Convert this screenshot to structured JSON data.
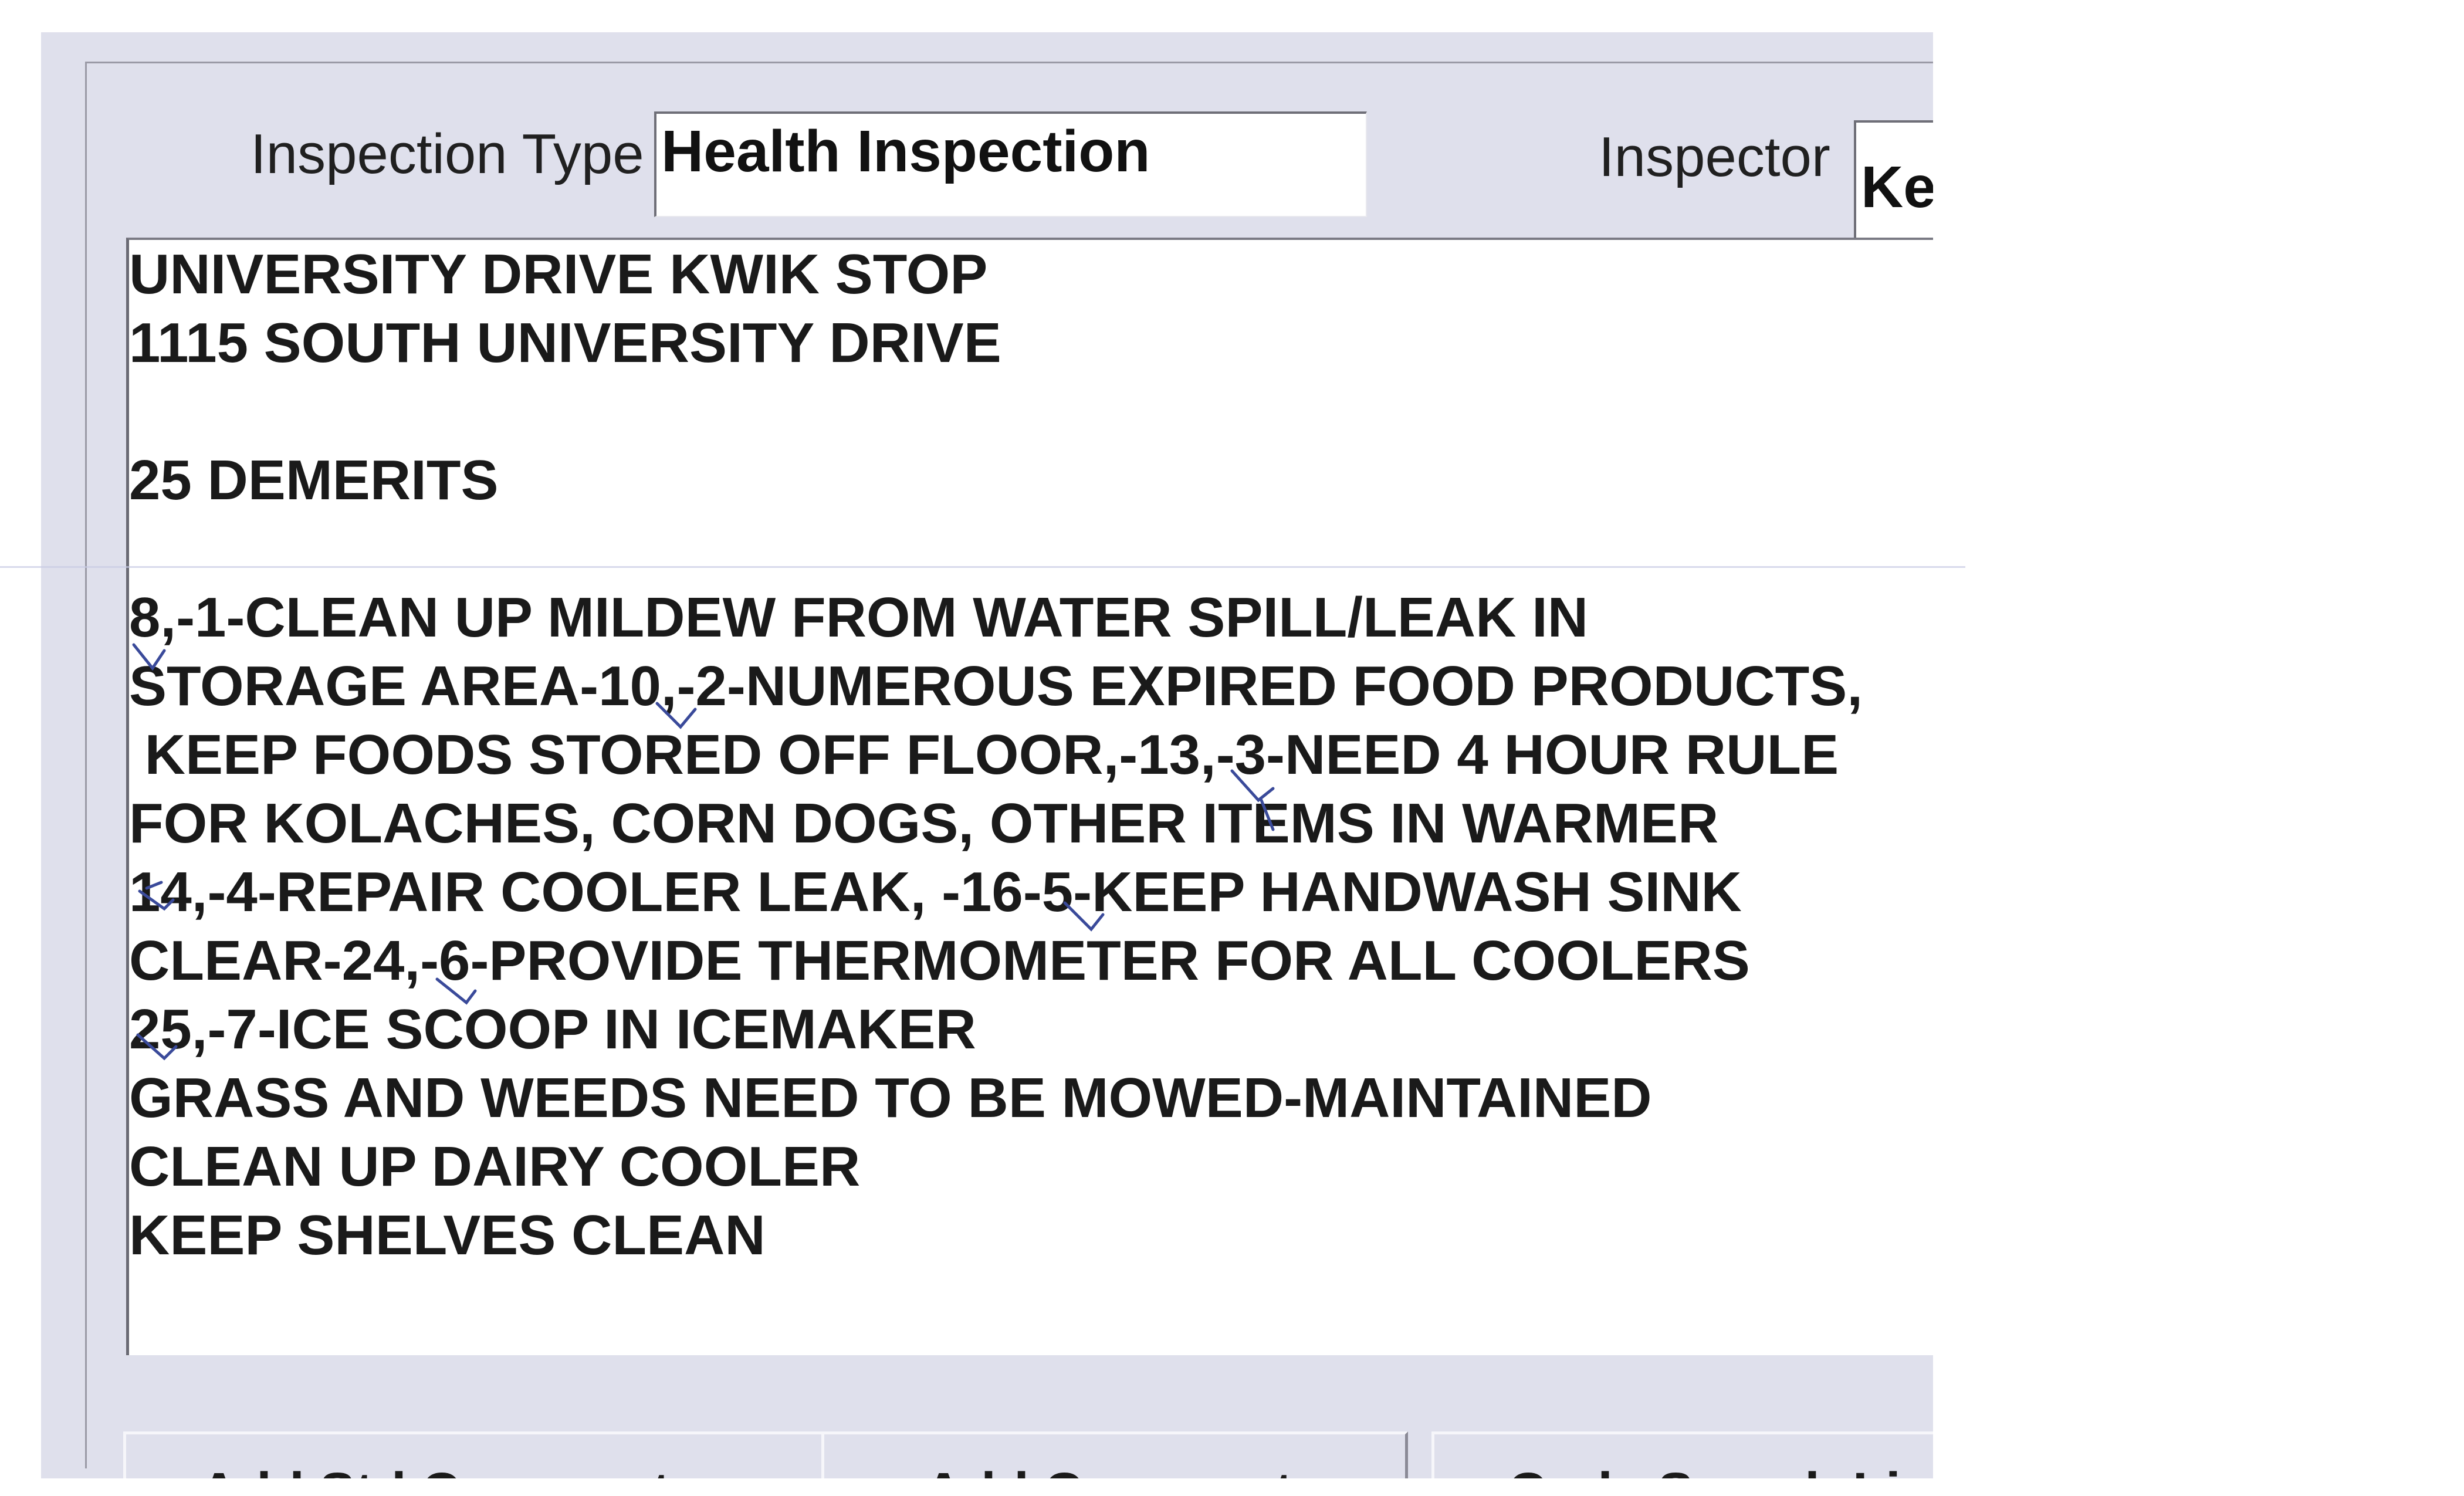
{
  "inspection_type": {
    "label": "Inspection Type",
    "value": "Health Inspection"
  },
  "inspector": {
    "label": "Inspector",
    "value": "Ke"
  },
  "comments": {
    "lines": [
      "UNIVERSITY DRIVE KWIK STOP",
      "1115 SOUTH UNIVERSITY DRIVE",
      "",
      "25 DEMERITS",
      "",
      "8,-1-CLEAN UP MILDEW FROM WATER SPILL/LEAK IN",
      "STORAGE AREA-10,-2-NUMEROUS EXPIRED FOOD PRODUCTS,",
      " KEEP FOODS STORED OFF FLOOR,-13,-3-NEED 4 HOUR RULE",
      "FOR KOLACHES, CORN DOGS, OTHER ITEMS IN WARMER",
      "14,-4-REPAIR COOLER LEAK, -16-5-KEEP HANDWASH SINK",
      "CLEAR-24,-6-PROVIDE THERMOMETER FOR ALL COOLERS",
      "25,-7-ICE SCOOP IN ICEMAKER",
      "GRASS AND WEEDS NEED TO BE MOWED-MAINTAINED",
      "CLEAN UP DAIRY COOLER",
      "KEEP SHELVES CLEAN"
    ]
  },
  "buttons": {
    "add_std_comments": {
      "pre": "Add ",
      "mnemonic": "S",
      "post": "td Comments"
    },
    "add_comment": {
      "pre": "",
      "mnemonic": "A",
      "post": "dd Comment"
    },
    "code_search": {
      "pre": "",
      "mnemonic": "",
      "post": "Code Search Li"
    }
  },
  "colors": {
    "dialog_bg": "#dfe0ec",
    "field_bg": "#ffffff",
    "text": "#1a1a1a",
    "pen_marks": "#3a4a9a"
  }
}
